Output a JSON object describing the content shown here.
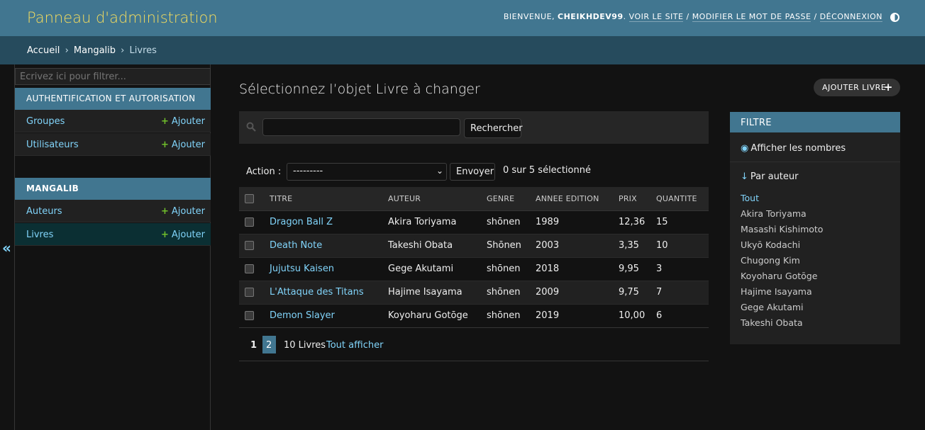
{
  "header": {
    "site_name": "Panneau d'administration",
    "welcome": "Bienvenue, ",
    "username": "CHEIKHDEV99",
    "view_site": "Voir le site",
    "change_password": "Modifier le mot de passe",
    "logout": "Déconnexion",
    "sep": " / "
  },
  "breadcrumbs": {
    "home": "Accueil",
    "app": "Mangalib",
    "model": "Livres",
    "sep": "›"
  },
  "sidebar": {
    "filter_placeholder": "Écrivez ici pour filtrer...",
    "toggle": "«",
    "modules": [
      {
        "caption": "Authentification et autorisation",
        "models": [
          {
            "label": "Groupes",
            "add": "Ajouter"
          },
          {
            "label": "Utilisateurs",
            "add": "Ajouter"
          }
        ]
      },
      {
        "caption": "Mangalib",
        "models": [
          {
            "label": "Auteurs",
            "add": "Ajouter"
          },
          {
            "label": "Livres",
            "add": "Ajouter"
          }
        ]
      }
    ]
  },
  "main": {
    "title": "Sélectionnez l’objet Livre à changer",
    "add_button": "Ajouter Livre",
    "search_button": "Rechercher",
    "search_value": "",
    "action_label": "Action :",
    "action_selected": "---------",
    "go_button": "Envoyer",
    "selection_counter": "0 sur 5 sélectionné",
    "columns": [
      "Titre",
      "Auteur",
      "Genre",
      "Annee edition",
      "Prix",
      "Quantite"
    ],
    "rows": [
      [
        "Dragon Ball Z",
        "Akira Toriyama",
        "shōnen",
        "1989",
        "12,36",
        "15"
      ],
      [
        "Death Note",
        "Takeshi Obata",
        "Shōnen",
        "2003",
        "3,35",
        "10"
      ],
      [
        "Jujutsu Kaisen",
        "Gege Akutami",
        "shōnen",
        "2018",
        "9,95",
        "3"
      ],
      [
        "L'Attaque des Titans",
        "Hajime Isayama",
        "shōnen",
        "2009",
        "9,75",
        "7"
      ],
      [
        "Demon Slayer",
        "Koyoharu Gotōge",
        "shōnen",
        "2019",
        "10,00",
        "6"
      ]
    ],
    "paginator": {
      "current": "1",
      "next": "2",
      "count": "10 Livres",
      "show_all": "Tout afficher"
    }
  },
  "filter": {
    "title": "Filtre",
    "show_counts": "Afficher les nombres",
    "by_author": "Par auteur",
    "choices": [
      "Tout",
      "Akira Toriyama",
      "Masashi Kishimoto",
      "Ukyō Kodachi",
      "Chugong Kim",
      "Koyoharu Gotōge",
      "Hajime Isayama",
      "Gege Akutami",
      "Takeshi Obata"
    ]
  },
  "colors": {
    "header": "#417690",
    "breadcrumbs": "#264b5d",
    "site_name": "#f5dd5d",
    "link": "#81d4fa",
    "add_plus": "#70bf2b"
  },
  "icons": [
    "search-icon",
    "plus-icon",
    "eye-icon",
    "arrow-down-icon",
    "theme-toggle-icon",
    "chevron-down-icon"
  ]
}
